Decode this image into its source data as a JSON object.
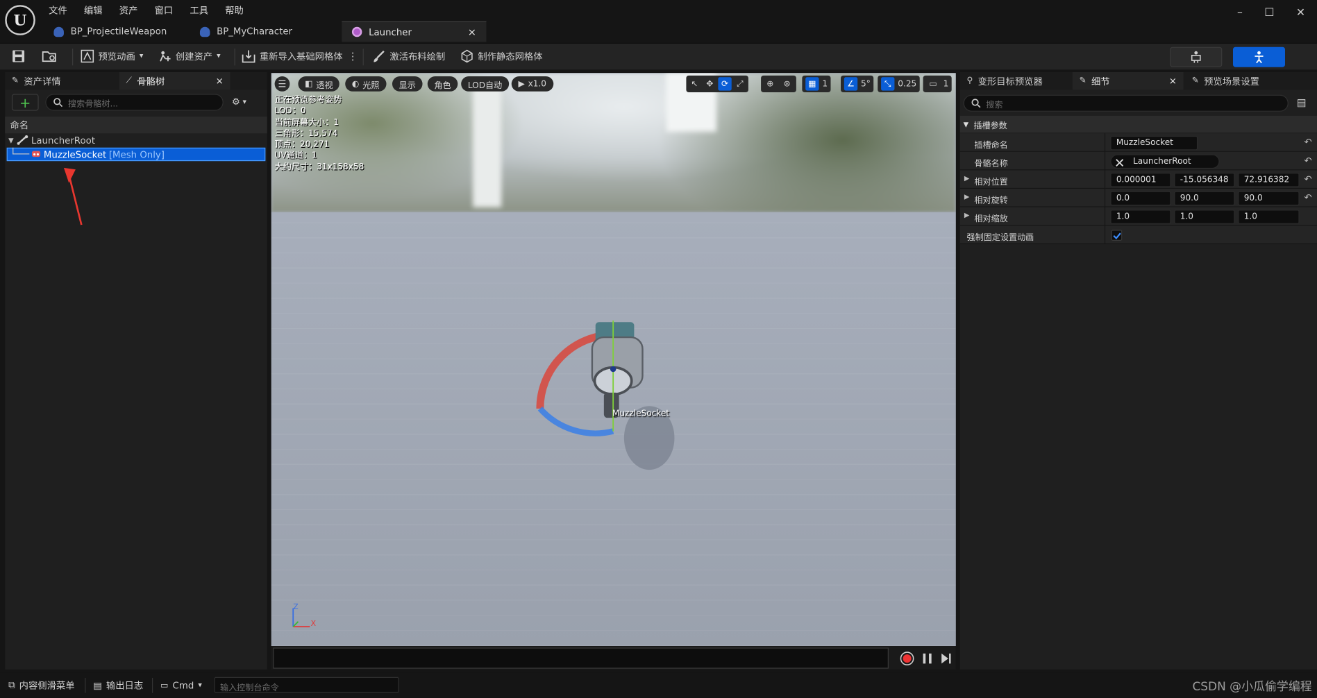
{
  "menu": [
    "文件",
    "编辑",
    "资产",
    "窗口",
    "工具",
    "帮助"
  ],
  "doc_tabs": [
    {
      "label": "BP_ProjectileWeapon"
    },
    {
      "label": "BP_MyCharacter"
    },
    {
      "label": "Launcher",
      "close": "×"
    }
  ],
  "window_controls": {
    "minimize": "–",
    "maximize": "☐",
    "close": "✕"
  },
  "toolbar": {
    "preview_anim": "预览动画",
    "create_asset": "创建资产",
    "reimport_mesh": "重新导入基础网格体",
    "activate_cloth": "激活布料绘制",
    "make_static_mesh": "制作静态网格体"
  },
  "left_panel": {
    "tabs": [
      {
        "label": "资产详情"
      },
      {
        "label": "骨骼树",
        "close": "×"
      }
    ],
    "add": "+",
    "search_placeholder": "搜索骨骼树...",
    "column_header": "命名",
    "tree": [
      {
        "label": "LauncherRoot",
        "tag": ""
      },
      {
        "label": "MuzzleSocket",
        "tag": "[Mesh Only]"
      }
    ]
  },
  "viewport": {
    "toolbar": {
      "perspective": "透视",
      "lighting": "光照",
      "show": "显示",
      "character": "角色",
      "lod": "LOD自动",
      "speed": "x1.0",
      "grid_value": "1",
      "angle_value": "5°",
      "scale_value": "0.25",
      "camera_value": "1"
    },
    "stats": [
      "正在预览参考姿势",
      "LOD：0",
      "当前屏幕大小：1",
      "三角形：15,574",
      "顶点：20,271",
      "UV通道：1",
      "大约尺寸：31x158x58"
    ],
    "socket_label": "MuzzleSocket",
    "axis": {
      "z": "Z",
      "x": "X"
    }
  },
  "right_panel": {
    "tabs": [
      {
        "label": "变形目标预览器"
      },
      {
        "label": "细节",
        "close": "×"
      },
      {
        "label": "预览场景设置"
      }
    ],
    "search_placeholder": "搜索",
    "section": "插槽参数",
    "socket_name_label": "插槽命名",
    "socket_name_value": "MuzzleSocket",
    "bone_name_label": "骨骼名称",
    "bone_name_value": "LauncherRoot",
    "rel_location_label": "相对位置",
    "rel_location": [
      "0.000001",
      "-15.056348",
      "72.916382"
    ],
    "rel_rotation_label": "相对旋转",
    "rel_rotation": [
      "0.0",
      "90.0",
      "90.0"
    ],
    "rel_scale_label": "相对缩放",
    "rel_scale": [
      "1.0",
      "1.0",
      "1.0"
    ],
    "force_anim_label": "强制固定设置动画",
    "force_anim_checked": true
  },
  "bottom": {
    "content_drawer": "内容侧滑菜单",
    "output_log": "输出日志",
    "cmd": "Cmd",
    "console_placeholder": "输入控制台命令",
    "watermark": "CSDN @小瓜偷学编程"
  },
  "colors": {
    "accent": "#0a5ed6",
    "add_green": "#4fc44f",
    "annotation_arrow": "#e8372f"
  }
}
